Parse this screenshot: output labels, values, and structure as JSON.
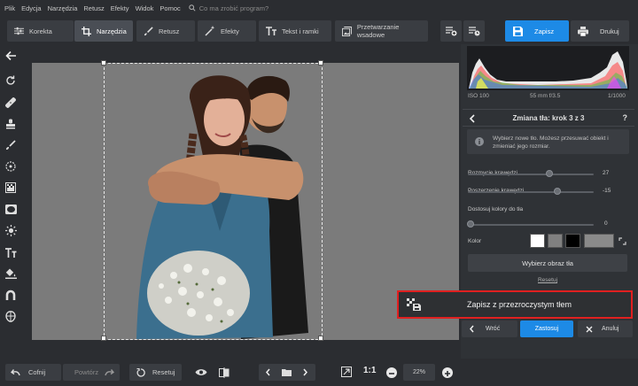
{
  "menu": [
    "Plik",
    "Edycja",
    "Narzędzia",
    "Retusz",
    "Efekty",
    "Widok",
    "Pomoc"
  ],
  "search_placeholder": "Co ma zrobić program?",
  "tabs": [
    {
      "label": "Korekta",
      "icon": "sliders-icon"
    },
    {
      "label": "Narzędzia",
      "icon": "crop-icon"
    },
    {
      "label": "Retusz",
      "icon": "brush-icon"
    },
    {
      "label": "Efekty",
      "icon": "magic-wand-icon"
    },
    {
      "label": "Tekst i ramki",
      "icon": "text-icon"
    },
    {
      "label": "Przetwarzanie wsadowe",
      "icon": "batch-icon"
    }
  ],
  "active_tab": "Narzędzia",
  "save_label": "Zapisz",
  "print_label": "Drukuj",
  "exif": {
    "iso": "ISO 100",
    "lens": "55 mm f/3.5",
    "shutter": "1/1000"
  },
  "panel": {
    "title": "Zmiana tła: krok 3 z 3",
    "help": "?",
    "info": "Wybierz nowe tło. Możesz przesuwać obiekt i zmieniać jego rozmiar.",
    "sliders": [
      {
        "label": "Rozmycie krawędzi",
        "value": "27"
      },
      {
        "label": "Poszerzenie krawędzi",
        "value": "-15"
      },
      {
        "label": "Dostosuj kolory do tła",
        "value": "0"
      }
    ],
    "color_label": "Kolor",
    "swatches": [
      "#ffffff",
      "#808080",
      "#000000",
      "#8a8a8a"
    ],
    "choose_bg": "Wybierz obraz tła",
    "reset": "Resetuj"
  },
  "highlight_label": "Zapisz z przezroczystym tłem",
  "footer_buttons": {
    "back": "Wróć",
    "apply": "Zastosuj",
    "cancel": "Anuluj"
  },
  "bottom": {
    "undo": "Cofnij",
    "redo": "Powtórz",
    "reset": "Resetuj",
    "ratio": "1:1",
    "zoom": "22%"
  },
  "colors": {
    "accent": "#1d8ae6",
    "highlight_border": "#e02020"
  }
}
